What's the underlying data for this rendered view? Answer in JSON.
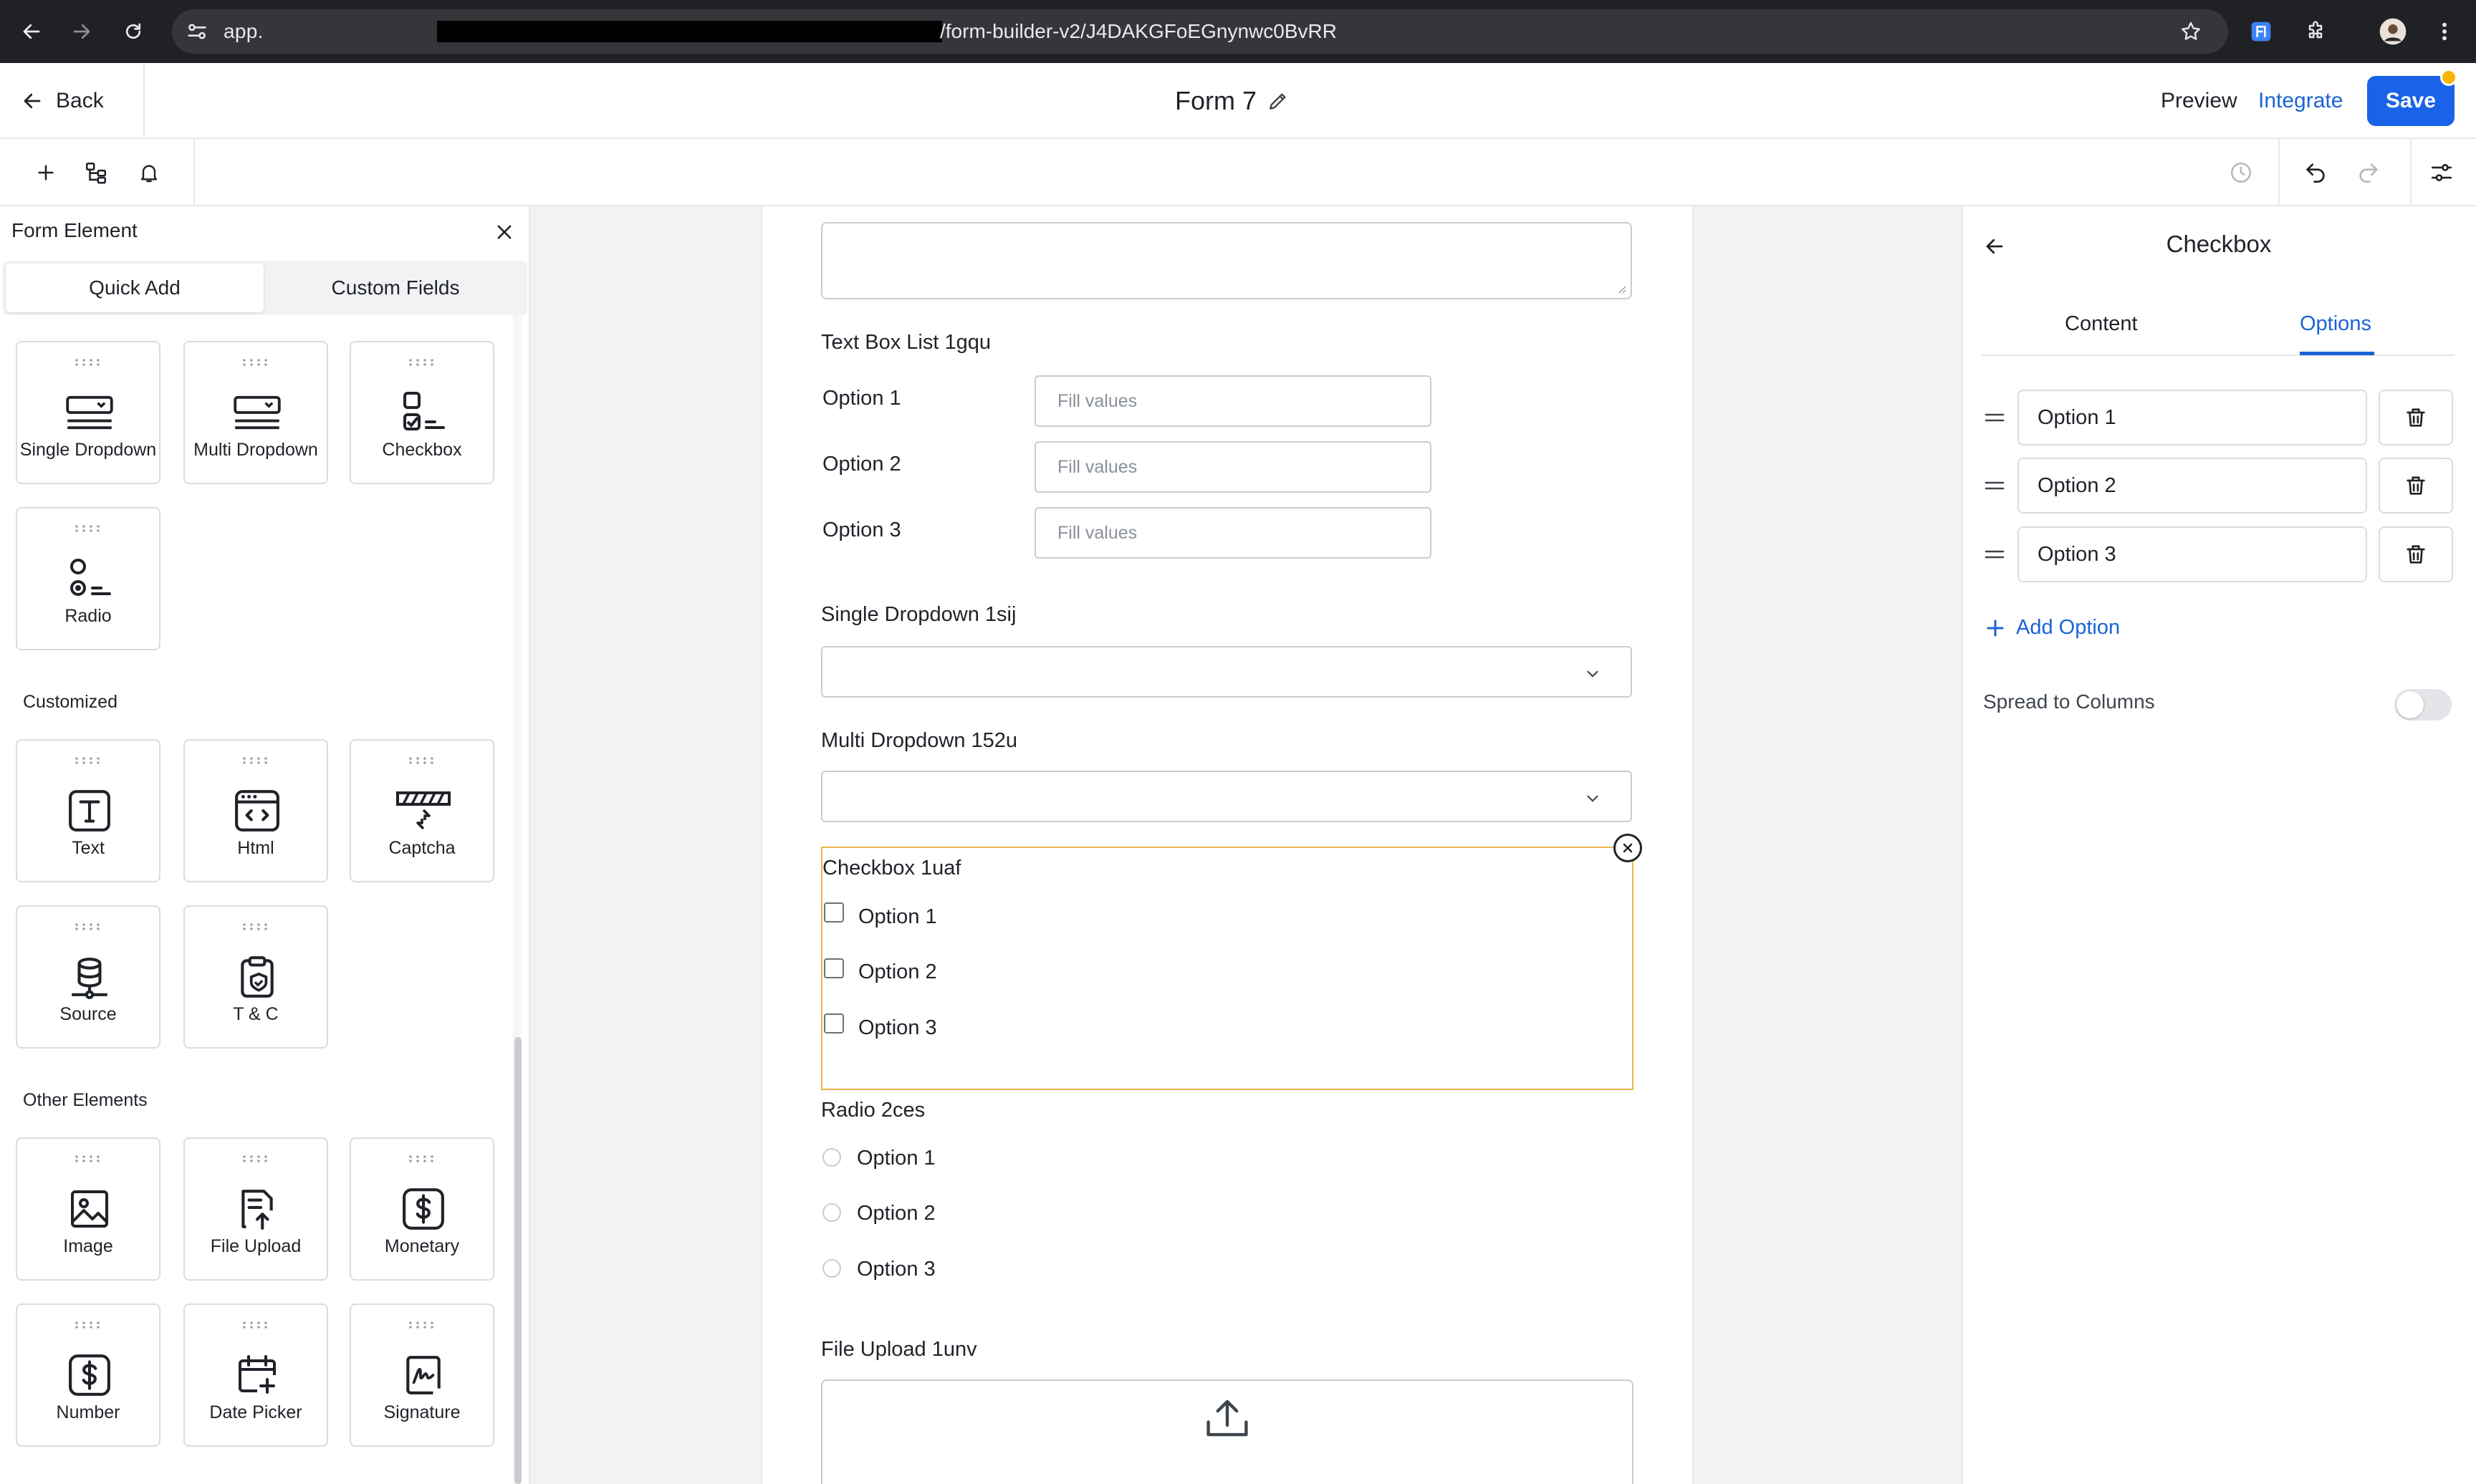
{
  "browser": {
    "url_prefix": "app.",
    "url_path": "/form-builder-v2/J4DAKGFoEGnynwc0BvRR"
  },
  "header": {
    "back_label": "Back",
    "form_title": "Form 7",
    "preview_label": "Preview",
    "integrate_label": "Integrate",
    "save_label": "Save"
  },
  "left_panel": {
    "title": "Form Element",
    "tabs": [
      "Quick Add",
      "Custom Fields"
    ],
    "quick_add": [
      "Single Dropdown",
      "Multi Dropdown",
      "Checkbox",
      "Radio"
    ],
    "customized_heading": "Customized",
    "customized": [
      "Text",
      "Html",
      "Captcha",
      "Source",
      "T & C"
    ],
    "other_heading": "Other Elements",
    "other": [
      "Image",
      "File Upload",
      "Monetary",
      "Number",
      "Date Picker",
      "Signature"
    ]
  },
  "form": {
    "textbox_list": {
      "label": "Text Box List 1gqu",
      "rows": [
        {
          "label": "Option 1",
          "placeholder": "Fill values"
        },
        {
          "label": "Option 2",
          "placeholder": "Fill values"
        },
        {
          "label": "Option 3",
          "placeholder": "Fill values"
        }
      ]
    },
    "single_dropdown_label": "Single Dropdown 1sij",
    "multi_dropdown_label": "Multi Dropdown 152u",
    "checkbox": {
      "label": "Checkbox 1uaf",
      "options": [
        "Option 1",
        "Option 2",
        "Option 3"
      ]
    },
    "radio": {
      "label": "Radio 2ces",
      "options": [
        "Option 1",
        "Option 2",
        "Option 3"
      ]
    },
    "file_upload_label": "File Upload 1unv"
  },
  "right_panel": {
    "title": "Checkbox",
    "tabs": [
      "Content",
      "Options"
    ],
    "active_tab": "Options",
    "options": [
      "Option 1",
      "Option 2",
      "Option 3"
    ],
    "add_option_label": "Add Option",
    "spread_label": "Spread to Columns",
    "spread_enabled": false
  },
  "colors": {
    "accent": "#1a62e8",
    "selected_border": "#e8b54a",
    "notification_dot": "#f7b500"
  }
}
